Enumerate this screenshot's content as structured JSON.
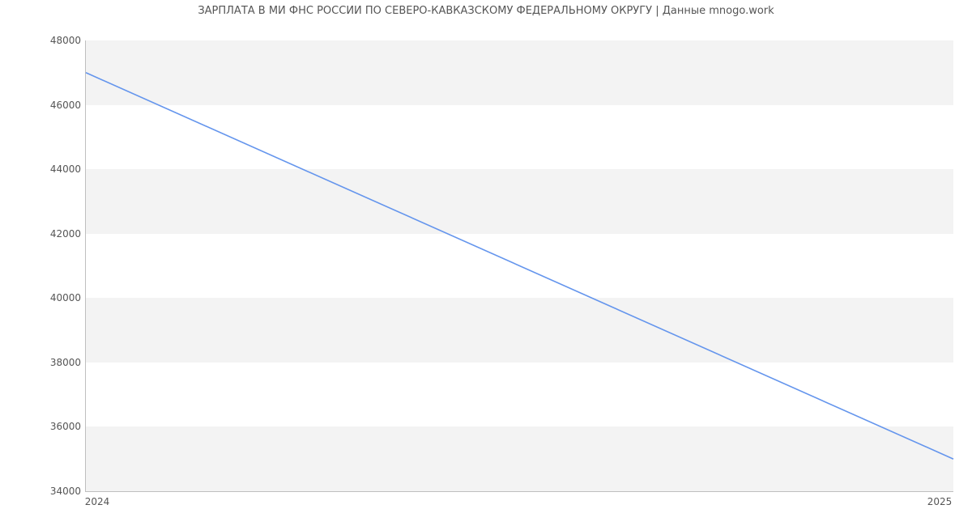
{
  "chart_data": {
    "type": "line",
    "title": "ЗАРПЛАТА В МИ ФНС РОССИИ ПО СЕВЕРО-КАВКАЗСКОМУ ФЕДЕРАЛЬНОМУ ОКРУГУ | Данные mnogo.work",
    "x": [
      2024,
      2025
    ],
    "values": [
      47000,
      35000
    ],
    "xlabel": "",
    "ylabel": "",
    "xlim": [
      2024,
      2025
    ],
    "ylim": [
      34000,
      48000
    ],
    "y_ticks": [
      34000,
      36000,
      38000,
      40000,
      42000,
      44000,
      46000,
      48000
    ],
    "x_ticks": [
      2024,
      2025
    ],
    "line_color": "#6495ed",
    "band_color": "#f3f3f3"
  },
  "y_tick_labels": {
    "t0": "34000",
    "t1": "36000",
    "t2": "38000",
    "t3": "40000",
    "t4": "42000",
    "t5": "44000",
    "t6": "46000",
    "t7": "48000"
  },
  "x_tick_labels": {
    "t0": "2024",
    "t1": "2025"
  }
}
